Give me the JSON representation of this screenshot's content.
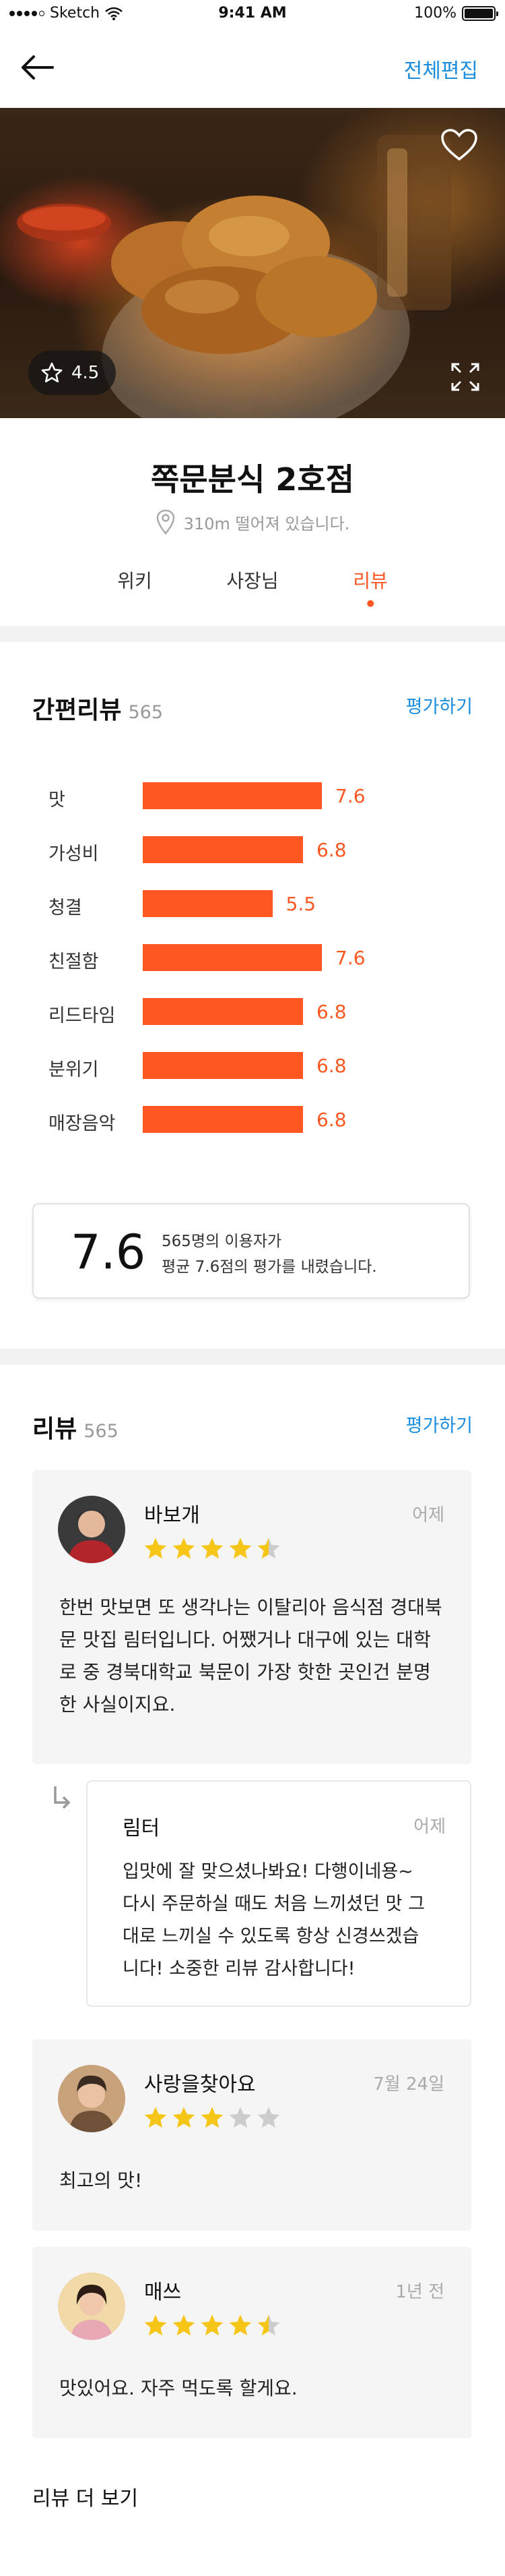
{
  "status_bar": {
    "carrier": "Sketch",
    "time": "9:41 AM",
    "battery": "100%",
    "battery_level": 1.0
  },
  "nav": {
    "back_icon": "arrow-left-icon",
    "edit_label": "전체편집"
  },
  "hero": {
    "rating": "4.5",
    "heart_icon": "heart-outline-icon",
    "expand_icon": "expand-icon"
  },
  "store": {
    "name": "쪽문분식 2호점",
    "distance": "310m 떨어져 있습니다."
  },
  "tabs": [
    {
      "label": "위키",
      "active": false
    },
    {
      "label": "사장님",
      "active": false
    },
    {
      "label": "리뷰",
      "active": true
    }
  ],
  "quick_review": {
    "title": "간편리뷰",
    "count": "565",
    "action": "평가하기"
  },
  "chart_data": {
    "type": "bar",
    "orientation": "horizontal",
    "categories": [
      "맛",
      "가성비",
      "청결",
      "친절함",
      "리드타임",
      "분위기",
      "매장음악"
    ],
    "values": [
      7.6,
      6.8,
      5.5,
      7.6,
      6.8,
      6.8,
      6.8
    ],
    "value_labels": [
      "7.6",
      "6.8",
      "5.5",
      "7.6",
      "6.8",
      "6.8",
      "6.8"
    ],
    "xlim": [
      0,
      10
    ],
    "color": "#ff5722",
    "grid": false
  },
  "summary": {
    "score": "7.6",
    "line1": "565명의 이용자가",
    "line2": "평균 7.6점의 평가를 내렸습니다."
  },
  "reviews_section": {
    "title": "리뷰",
    "count": "565",
    "action": "평가하기"
  },
  "reviews": [
    {
      "name": "바보개",
      "date": "어제",
      "stars": 4.5,
      "lines": [
        "한번 맛보면 또 생각나는 이탈리아 음식점 경대북",
        "문 맛집 림터입니다. 어쨌거나 대구에 있는 대학",
        "로 중 경북대학교 북문이 가장 핫한 곳인건 분명",
        "한 사실이지요."
      ]
    },
    {
      "name": "사랑을찾아요",
      "date": "7월 24일",
      "stars": 3,
      "lines": [
        "최고의 맛!"
      ]
    },
    {
      "name": "매쓰",
      "date": "1년 전",
      "stars": 4.5,
      "lines": [
        "맛있어요. 자주 먹도록 할게요."
      ]
    }
  ],
  "reply": {
    "name": "림터",
    "date": "어제",
    "lines": [
      "입맛에 잘 맞으셨나봐요! 다행이네용~",
      "다시 주문하실 때도 처음 느끼셨던 맛 그",
      "대로 느끼실 수 있도록 항상 신경쓰겠습",
      "니다! 소중한 리뷰 감사합니다!"
    ]
  },
  "more_label": "리뷰 더 보기",
  "colors": {
    "accent": "#ff5722",
    "link": "#1a8ddf",
    "star": "#f5c518",
    "star_empty": "#cccccc"
  }
}
